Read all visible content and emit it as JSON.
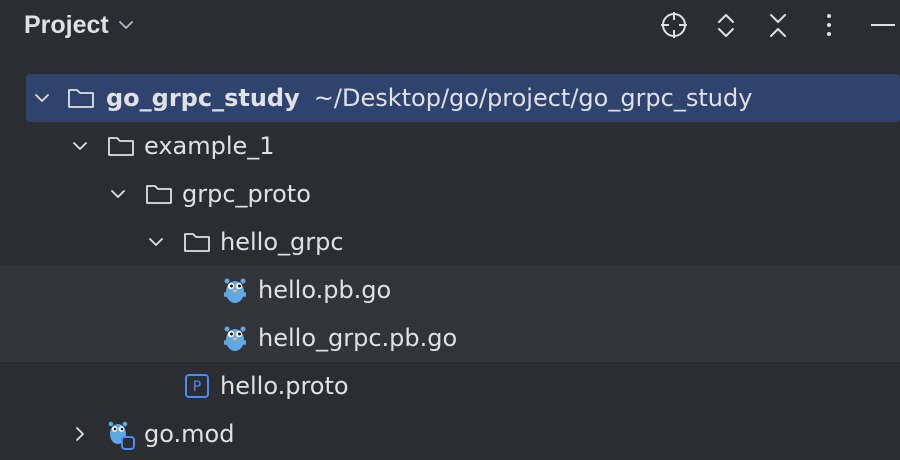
{
  "panel": {
    "title": "Project"
  },
  "toolbar": {
    "buttons": [
      {
        "icon": "locate-icon"
      },
      {
        "icon": "expand-collapse-icon"
      },
      {
        "icon": "collapse-all-icon"
      },
      {
        "icon": "more-options-icon"
      },
      {
        "icon": "minimize-icon"
      }
    ]
  },
  "tree": {
    "root": {
      "name": "go_grpc_study",
      "path": "~/Desktop/go/project/go_grpc_study"
    },
    "example_1": {
      "name": "example_1"
    },
    "grpc_proto": {
      "name": "grpc_proto"
    },
    "hello_grpc": {
      "name": "hello_grpc"
    },
    "hello_pb": {
      "name": "hello.pb.go"
    },
    "hello_grpc_pb": {
      "name": "hello_grpc.pb.go"
    },
    "hello_proto": {
      "name": "hello.proto",
      "icon_letter": "P"
    },
    "go_mod": {
      "name": "go.mod"
    }
  },
  "colors": {
    "background": "#2b2d30",
    "selection": "#2e436e",
    "hover_row": "#323438",
    "text": "#dfe1e5",
    "gopher": "#5fa8e6",
    "proto_icon": "#4c8af5"
  }
}
